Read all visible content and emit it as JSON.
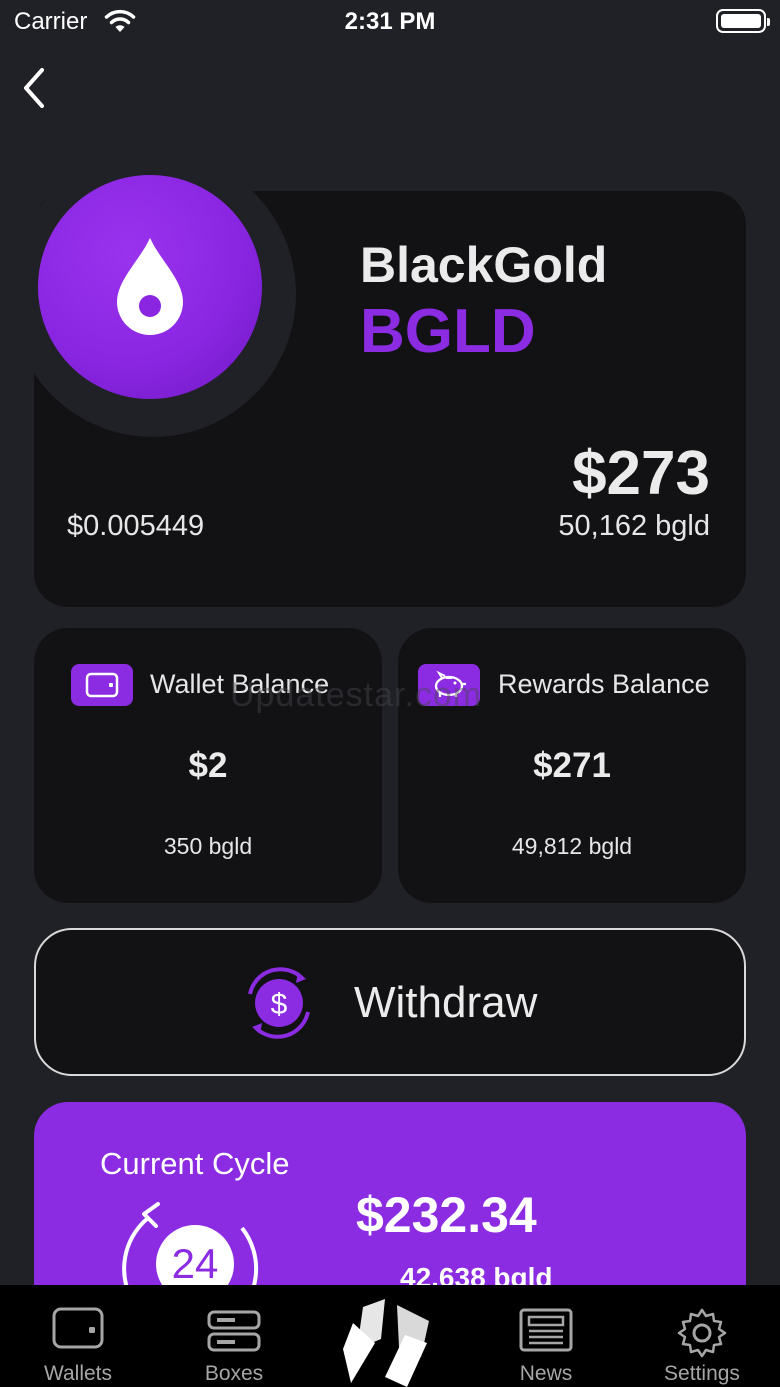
{
  "status_bar": {
    "carrier": "Carrier",
    "time": "2:31 PM"
  },
  "token": {
    "name": "BlackGold",
    "symbol": "BGLD",
    "price": "$0.005449",
    "value_usd": "$273",
    "amount": "50,162 bgld",
    "accent_color": "#8b2be2"
  },
  "wallet_balance": {
    "label": "Wallet Balance",
    "usd": "$2",
    "amount": "350 bgld",
    "icon": "wallet-icon"
  },
  "rewards_balance": {
    "label": "Rewards Balance",
    "usd": "$271",
    "amount": "49,812 bgld",
    "icon": "piggy-bank-icon"
  },
  "watermark": "Updatestar.com",
  "withdraw": {
    "label": "Withdraw",
    "icon": "dollar-exchange-icon"
  },
  "cycle": {
    "title": "Current Cycle",
    "hours": "24",
    "usd": "$232.34",
    "amount": "42,638 bgld"
  },
  "tabs": [
    {
      "label": "Wallets",
      "icon": "wallet-icon"
    },
    {
      "label": "Boxes",
      "icon": "server-icon"
    },
    {
      "label": "",
      "icon": "brand-logo-icon"
    },
    {
      "label": "News",
      "icon": "newspaper-icon"
    },
    {
      "label": "Settings",
      "icon": "gear-icon"
    }
  ]
}
